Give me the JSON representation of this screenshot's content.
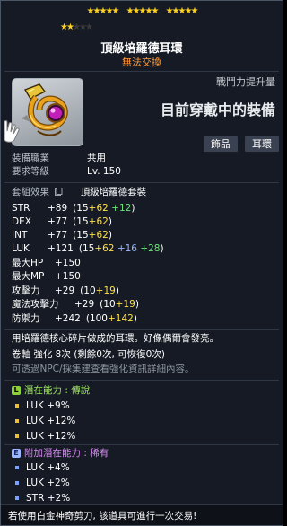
{
  "stars": {
    "row1_on": 15,
    "row2_on": 2,
    "row2_total": 5,
    "glyph": "★"
  },
  "item": {
    "name": "頂級培羅德耳環",
    "trade_status": "無法交換",
    "icon": "earring-icon"
  },
  "power": {
    "label": "戰鬥力提升量",
    "status": "目前穿戴中的裝備"
  },
  "tags": {
    "category": "飾品",
    "subcategory": "耳環"
  },
  "requirements": {
    "job_label": "裝備職業",
    "job_value": "共用",
    "level_label": "要求等級",
    "level_value": "Lv. 150"
  },
  "set": {
    "label": "套組效果",
    "icon": "copy-icon",
    "name": "頂級培羅德套裝"
  },
  "stats": [
    {
      "name": "STR",
      "total": "+89",
      "base": "15",
      "bonus": [
        {
          "text": "+62",
          "color": "yellow"
        },
        {
          "text": "+12",
          "color": "green"
        }
      ]
    },
    {
      "name": "DEX",
      "total": "+77",
      "base": "15",
      "bonus": [
        {
          "text": "+62",
          "color": "yellow"
        }
      ]
    },
    {
      "name": "INT",
      "total": "+77",
      "base": "15",
      "bonus": [
        {
          "text": "+62",
          "color": "yellow"
        }
      ]
    },
    {
      "name": "LUK",
      "total": "+121",
      "base": "15",
      "bonus": [
        {
          "text": "+62",
          "color": "yellow"
        },
        {
          "text": "+16",
          "color": "blue"
        },
        {
          "text": "+28",
          "color": "green"
        }
      ]
    },
    {
      "name": "最大HP",
      "total": "+150",
      "base": "",
      "bonus": []
    },
    {
      "name": "最大MP",
      "total": "+150",
      "base": "",
      "bonus": []
    },
    {
      "name": "攻擊力",
      "total": "+29",
      "base": "10",
      "bonus": [
        {
          "text": "+19",
          "color": "yellow"
        }
      ]
    },
    {
      "name": "魔法攻擊力",
      "total": "+29",
      "base": "10",
      "bonus": [
        {
          "text": "+19",
          "color": "yellow"
        }
      ]
    },
    {
      "name": "防禦力",
      "total": "+242",
      "base": "100",
      "bonus": [
        {
          "text": "+142",
          "color": "yellow"
        }
      ]
    }
  ],
  "description": "用培羅德核心碎片做成的耳環。好像偶爾會發亮。",
  "scroll": {
    "text": "卷軸 強化 8次 (剩餘0次, 可恢復0次)",
    "hint": "可透過NPC/採集建查看強化資訊詳細內容。"
  },
  "potential": {
    "icon_letter": "L",
    "label": "潛在能力 : 傳說",
    "lines": [
      "LUK +9%",
      "LUK +12%",
      "LUK +12%"
    ]
  },
  "additional_potential": {
    "icon_letter": "E",
    "label": "附加潛在能力 : 稀有",
    "lines": [
      "LUK +4%",
      "LUK +2%",
      "STR +2%"
    ]
  },
  "footer": "若使用白金神奇剪刀, 該道具可進行一次交易!",
  "colors": {
    "yellow": "#ffe04a",
    "blue": "#9bb8ff",
    "green": "#6be37a",
    "trade_orange": "#ff9a3c",
    "legend_green": "#9be35a",
    "rare_purple": "#d68af2"
  }
}
